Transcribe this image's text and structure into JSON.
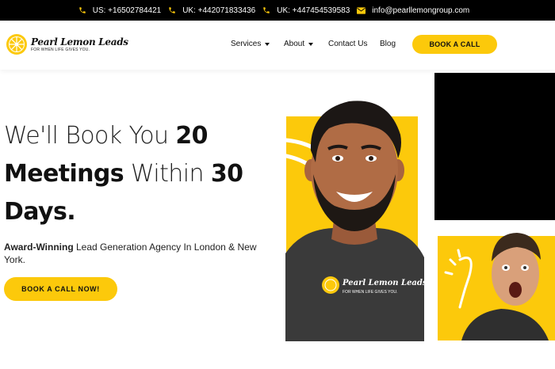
{
  "topbar": {
    "phones": [
      {
        "label": "US: +16502784421"
      },
      {
        "label": "UK: +442071833436"
      },
      {
        "label": "UK: +447454539583"
      }
    ],
    "email": "info@pearllemongroup.com"
  },
  "logo": {
    "name": "Pearl Lemon Leads",
    "tagline": "FOR WHEN LIFE GIVES YOU."
  },
  "nav": {
    "services": "Services",
    "about": "About",
    "contact": "Contact Us",
    "blog": "Blog",
    "cta": "BOOK A CALL"
  },
  "hero": {
    "l1a": "We'll  Book You ",
    "l1b": "20",
    "l2a": "Meetings",
    "l2b": " Within ",
    "l2c": "30",
    "l3": "Days.",
    "sub_bold": "Award-Winning",
    "sub_rest": " Lead Generation Agency In London & New York.",
    "cta": "BOOK A CALL  NOW!"
  },
  "shirt_logo": {
    "name": "Pearl Lemon Leads",
    "tagline": "FOR WHEN LIFE GIVES YOU."
  },
  "colors": {
    "accent": "#fcc90b",
    "topbar_bg": "#000000",
    "text": "#111111"
  }
}
